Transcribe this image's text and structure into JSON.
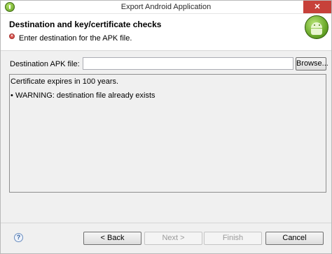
{
  "window": {
    "title": "Export Android Application",
    "close_glyph": "✕"
  },
  "header": {
    "title": "Destination and key/certificate checks",
    "message": "Enter destination for the APK file.",
    "error_glyph": "×"
  },
  "destination": {
    "label": "Destination APK file:",
    "value": "",
    "browse_label": "Browse..."
  },
  "panel": {
    "line1": "Certificate expires in 100 years.",
    "bullet": "•",
    "line2": "WARNING: destination file already exists"
  },
  "footer": {
    "help_glyph": "?",
    "back_label": "< Back",
    "next_label": "Next >",
    "finish_label": "Finish",
    "cancel_label": "Cancel"
  },
  "colors": {
    "close_button": "#c7413a",
    "error_icon": "#d9534f",
    "android_green": "#6aa82a"
  },
  "icons": [
    "android-app-icon",
    "close-icon",
    "error-icon",
    "android-banner-icon",
    "help-icon"
  ]
}
